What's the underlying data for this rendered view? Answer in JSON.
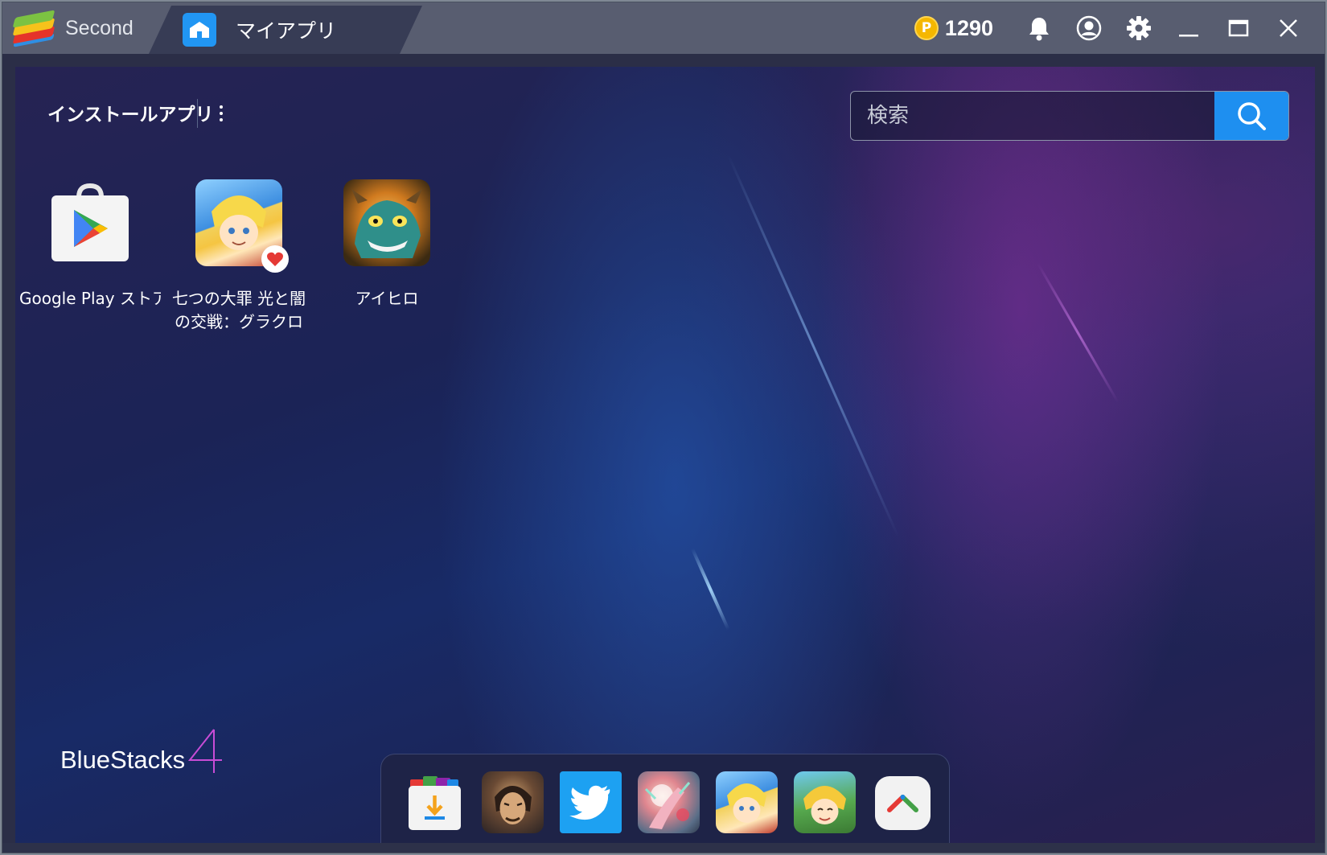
{
  "titlebar": {
    "inactive_tab_title": "Second",
    "active_tab_title": "マイアプリ",
    "coins": "1290",
    "coin_symbol": "P"
  },
  "home": {
    "section_title": "インストールアプリ",
    "search_placeholder": "検索",
    "apps": [
      {
        "label": "Google Play ストア",
        "icon": "google-play-icon"
      },
      {
        "label": "七つの大罪 光と闇の交戦：グラクロ",
        "icon": "nanatsu-no-taizai-icon",
        "badge": "heart"
      },
      {
        "label": "アイヒロ",
        "icon": "aihero-icon"
      }
    ],
    "brand": "BlueStacks",
    "brand_version": "4"
  },
  "dock": {
    "items": [
      "app-center-icon",
      "warrior-game-icon",
      "twitter-icon",
      "anime-game-icon",
      "nanatsu-no-taizai-icon",
      "nanatsu-character-icon",
      "more-apps-icon"
    ]
  },
  "colors": {
    "accent_blue": "#1e8ff0",
    "titlebar": "#585d70",
    "active_tab": "#373c55",
    "coin": "#f5b700"
  }
}
